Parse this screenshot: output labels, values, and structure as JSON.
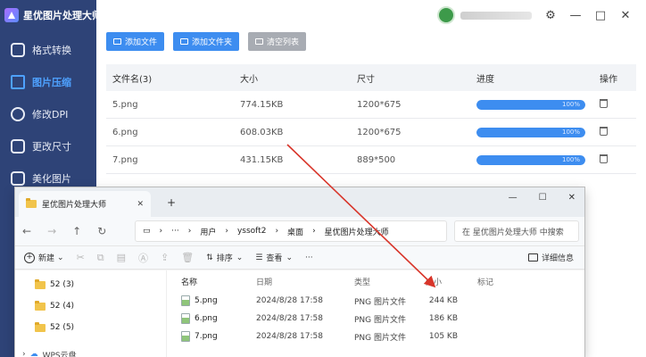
{
  "app": {
    "title": "星优图片处理大师",
    "nav": [
      {
        "label": "格式转换",
        "active": false
      },
      {
        "label": "图片压缩",
        "active": true
      },
      {
        "label": "修改DPI",
        "active": false
      },
      {
        "label": "更改尺寸",
        "active": false
      },
      {
        "label": "美化图片",
        "active": false
      }
    ],
    "window_controls": {
      "settings": "⚙",
      "minimize": "—",
      "maximize": "□",
      "close": "✕"
    }
  },
  "toolbar": {
    "add_file": "添加文件",
    "add_folder": "添加文件夹",
    "clear_list": "清空列表"
  },
  "table": {
    "headers": [
      "文件名(3)",
      "大小",
      "尺寸",
      "进度",
      "操作"
    ],
    "rows": [
      {
        "name": "5.png",
        "size": "774.15KB",
        "dims": "1200*675",
        "progress_text": "100%",
        "progress": 100
      },
      {
        "name": "6.png",
        "size": "608.03KB",
        "dims": "1200*675",
        "progress_text": "100%",
        "progress": 100
      },
      {
        "name": "7.png",
        "size": "431.15KB",
        "dims": "889*500",
        "progress_text": "100%",
        "progress": 100
      }
    ]
  },
  "explorer": {
    "tab_title": "星优图片处理大师",
    "tab_close": "✕",
    "new_tab": "+",
    "win_minimize": "—",
    "win_maximize": "☐",
    "win_close": "✕",
    "breadcrumb": [
      "用户",
      "yssoft2",
      "桌面",
      "星优图片处理大师"
    ],
    "search_placeholder": "在 星优图片处理大师 中搜索",
    "cmd": {
      "new": "新建",
      "sort": "排序",
      "view": "查看",
      "more": "···",
      "details": "详细信息"
    },
    "tree": [
      {
        "label": "52 (3)"
      },
      {
        "label": "52 (4)"
      },
      {
        "label": "52 (5)"
      }
    ],
    "tree_bottom": "WPS云盘",
    "file_headers": {
      "name": "名称",
      "date": "日期",
      "type": "类型",
      "size": "大小",
      "tag": "标记"
    },
    "files": [
      {
        "name": "5.png",
        "date": "2024/8/28 17:58",
        "type": "PNG 图片文件",
        "size": "244 KB"
      },
      {
        "name": "6.png",
        "date": "2024/8/28 17:58",
        "type": "PNG 图片文件",
        "size": "186 KB"
      },
      {
        "name": "7.png",
        "date": "2024/8/28 17:58",
        "type": "PNG 图片文件",
        "size": "105 KB"
      }
    ]
  },
  "colors": {
    "sidebar": "#2e4377",
    "accent": "#3d8df0",
    "annotation_arrow": "#d8352a"
  }
}
